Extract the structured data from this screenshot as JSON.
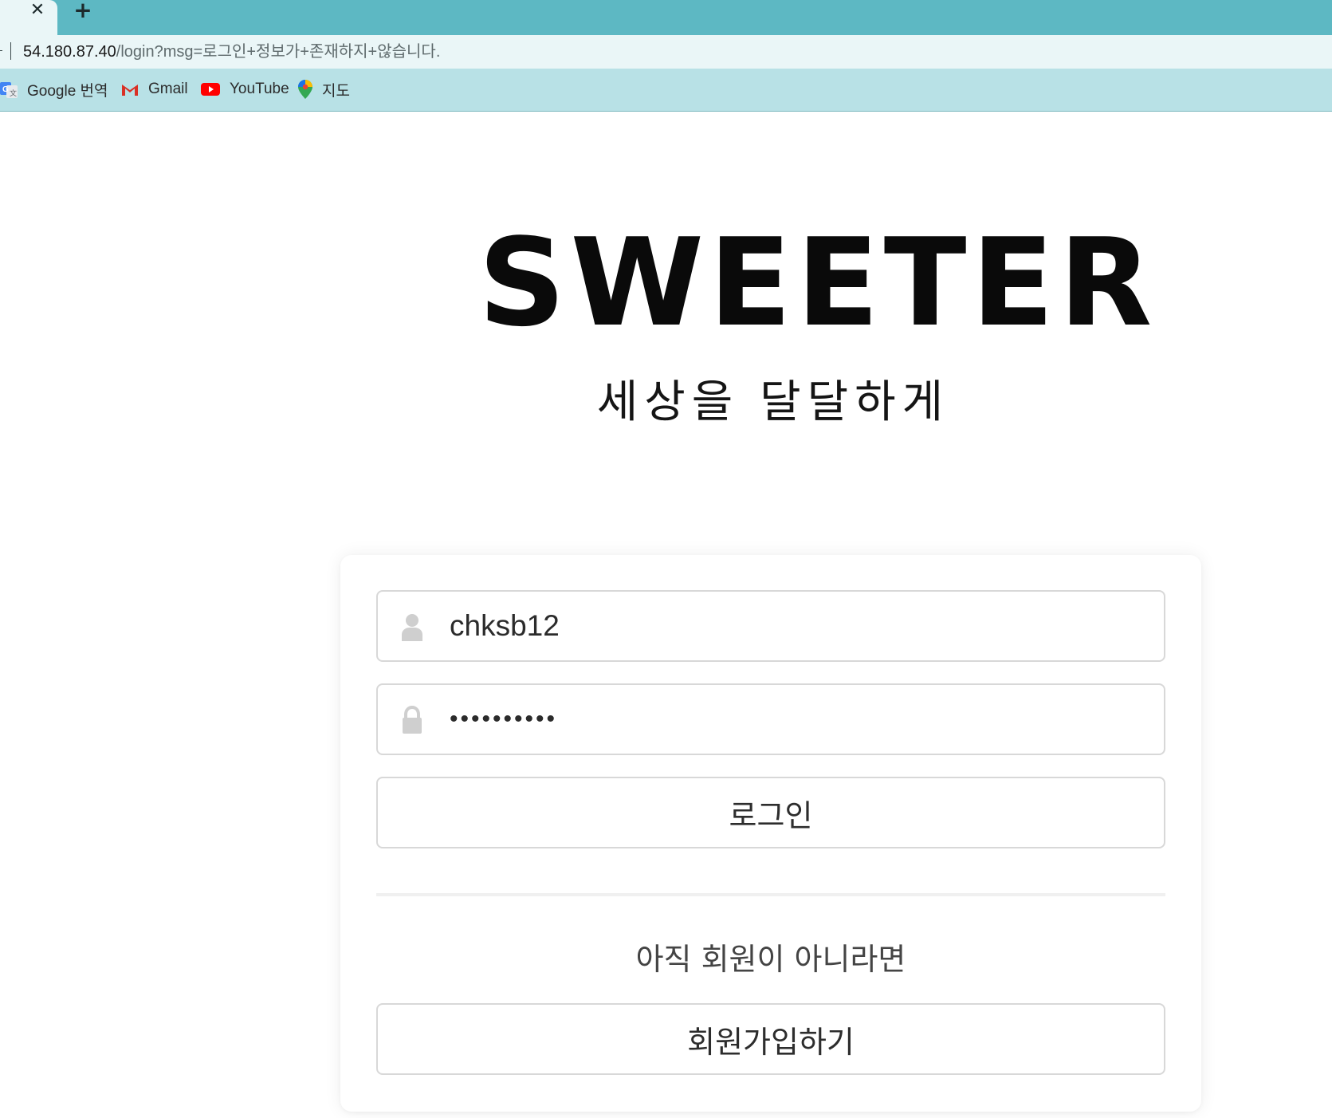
{
  "browser": {
    "tab_close_glyph": "✕",
    "new_tab_glyph": "+",
    "url_host": "54.180.87.40",
    "url_path": "/login?msg=로그인+정보가+존재하지+않습니다.",
    "bookmarks": [
      {
        "label": "Google 번역",
        "icon": "google-translate-icon"
      },
      {
        "label": "Gmail",
        "icon": "gmail-icon"
      },
      {
        "label": "YouTube",
        "icon": "youtube-icon"
      },
      {
        "label": "지도",
        "icon": "maps-pin-icon"
      }
    ]
  },
  "page": {
    "logo": "SWEETER",
    "tagline": "세상을 달달하게"
  },
  "login": {
    "username_value": "chksb12",
    "password_value": "••••••••••",
    "submit_label": "로그인",
    "signup_prompt": "아직 회원이 아니라면",
    "signup_label": "회원가입하기"
  },
  "colors": {
    "tabstrip": "#5db8c3",
    "addressbar": "#eaf6f7",
    "bookmarks_bar": "#b8e1e6",
    "field_border": "#d8d8d8",
    "icon_gray": "#cfcfcf"
  }
}
